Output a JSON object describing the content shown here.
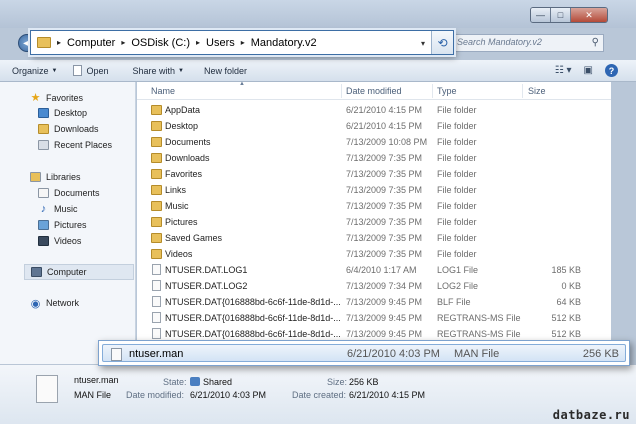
{
  "window": {
    "controls": {
      "minimize": "—",
      "maximize": "□",
      "close": "✕"
    }
  },
  "address": {
    "segments": [
      "Computer",
      "OSDisk (C:)",
      "Users",
      "Mandatory.v2"
    ],
    "separator": "▸",
    "dropdown": "▾",
    "refresh": "⟲"
  },
  "search": {
    "placeholder": "Search Mandatory.v2",
    "icon": "search-icon"
  },
  "toolbar": {
    "organize": "Organize",
    "open": "Open",
    "share_with": "Share with",
    "new_folder": "New folder"
  },
  "sidebar": {
    "favorites": "Favorites",
    "desktop": "Desktop",
    "downloads": "Downloads",
    "recent_places": "Recent Places",
    "libraries": "Libraries",
    "documents": "Documents",
    "music": "Music",
    "pictures": "Pictures",
    "videos": "Videos",
    "computer": "Computer",
    "network": "Network"
  },
  "columns": {
    "name": "Name",
    "date": "Date modified",
    "type": "Type",
    "size": "Size"
  },
  "files": [
    {
      "name": "AppData",
      "date": "6/21/2010 4:15 PM",
      "type": "File folder",
      "size": "",
      "kind": "folder"
    },
    {
      "name": "Desktop",
      "date": "6/21/2010 4:15 PM",
      "type": "File folder",
      "size": "",
      "kind": "folder"
    },
    {
      "name": "Documents",
      "date": "7/13/2009 10:08 PM",
      "type": "File folder",
      "size": "",
      "kind": "folder"
    },
    {
      "name": "Downloads",
      "date": "7/13/2009 7:35 PM",
      "type": "File folder",
      "size": "",
      "kind": "folder"
    },
    {
      "name": "Favorites",
      "date": "7/13/2009 7:35 PM",
      "type": "File folder",
      "size": "",
      "kind": "folder"
    },
    {
      "name": "Links",
      "date": "7/13/2009 7:35 PM",
      "type": "File folder",
      "size": "",
      "kind": "folder"
    },
    {
      "name": "Music",
      "date": "7/13/2009 7:35 PM",
      "type": "File folder",
      "size": "",
      "kind": "folder"
    },
    {
      "name": "Pictures",
      "date": "7/13/2009 7:35 PM",
      "type": "File folder",
      "size": "",
      "kind": "folder"
    },
    {
      "name": "Saved Games",
      "date": "7/13/2009 7:35 PM",
      "type": "File folder",
      "size": "",
      "kind": "folder"
    },
    {
      "name": "Videos",
      "date": "7/13/2009 7:35 PM",
      "type": "File folder",
      "size": "",
      "kind": "folder"
    },
    {
      "name": "NTUSER.DAT.LOG1",
      "date": "6/4/2010 1:17 AM",
      "type": "LOG1 File",
      "size": "185 KB",
      "kind": "file"
    },
    {
      "name": "NTUSER.DAT.LOG2",
      "date": "7/13/2009 7:34 PM",
      "type": "LOG2 File",
      "size": "0 KB",
      "kind": "file"
    },
    {
      "name": "NTUSER.DAT{016888bd-6c6f-11de-8d1d-...",
      "date": "7/13/2009 9:45 PM",
      "type": "BLF File",
      "size": "64 KB",
      "kind": "file"
    },
    {
      "name": "NTUSER.DAT{016888bd-6c6f-11de-8d1d-...",
      "date": "7/13/2009 9:45 PM",
      "type": "REGTRANS-MS File",
      "size": "512 KB",
      "kind": "file"
    },
    {
      "name": "NTUSER.DAT{016888bd-6c6f-11de-8d1d-...",
      "date": "7/13/2009 9:45 PM",
      "type": "REGTRANS-MS File",
      "size": "512 KB",
      "kind": "file"
    }
  ],
  "selected_file": {
    "name": "ntuser.man",
    "date": "6/21/2010 4:03 PM",
    "type": "MAN File",
    "size": "256 KB"
  },
  "details": {
    "name": "ntuser.man",
    "type": "MAN File",
    "state_label": "State:",
    "state_value": "Shared",
    "date_modified_label": "Date modified:",
    "date_modified_value": "6/21/2010 4:03 PM",
    "size_label": "Size:",
    "size_value": "256 KB",
    "date_created_label": "Date created:",
    "date_created_value": "6/21/2010 4:15 PM"
  },
  "watermark": "datbaze.ru"
}
